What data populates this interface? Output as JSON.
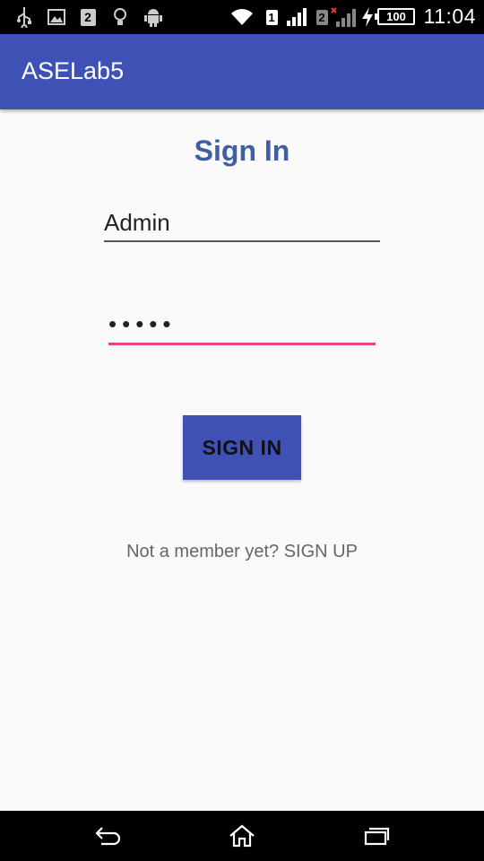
{
  "status_bar": {
    "time": "11:04",
    "battery": "100",
    "sim1": "1",
    "sim2": "2",
    "notification_badge": "2",
    "icons": [
      "usb-icon",
      "image-icon",
      "notification-2-icon",
      "bulb-icon",
      "android-icon",
      "wifi-icon",
      "sim1-signal-icon",
      "sim2-signal-icon",
      "charging-icon",
      "battery-icon"
    ]
  },
  "app_bar": {
    "title": "ASELab5"
  },
  "form": {
    "heading": "Sign In",
    "username_value": "Admin",
    "password_value": "•••••",
    "submit_label": "SIGN IN",
    "signup_text": "Not a member yet? SIGN UP"
  },
  "nav_bar": {
    "icons": [
      "back-icon",
      "home-icon",
      "recents-icon"
    ]
  },
  "colors": {
    "primary": "#3f51b5",
    "accent": "#e8457a",
    "heading": "#3f5ea3"
  }
}
